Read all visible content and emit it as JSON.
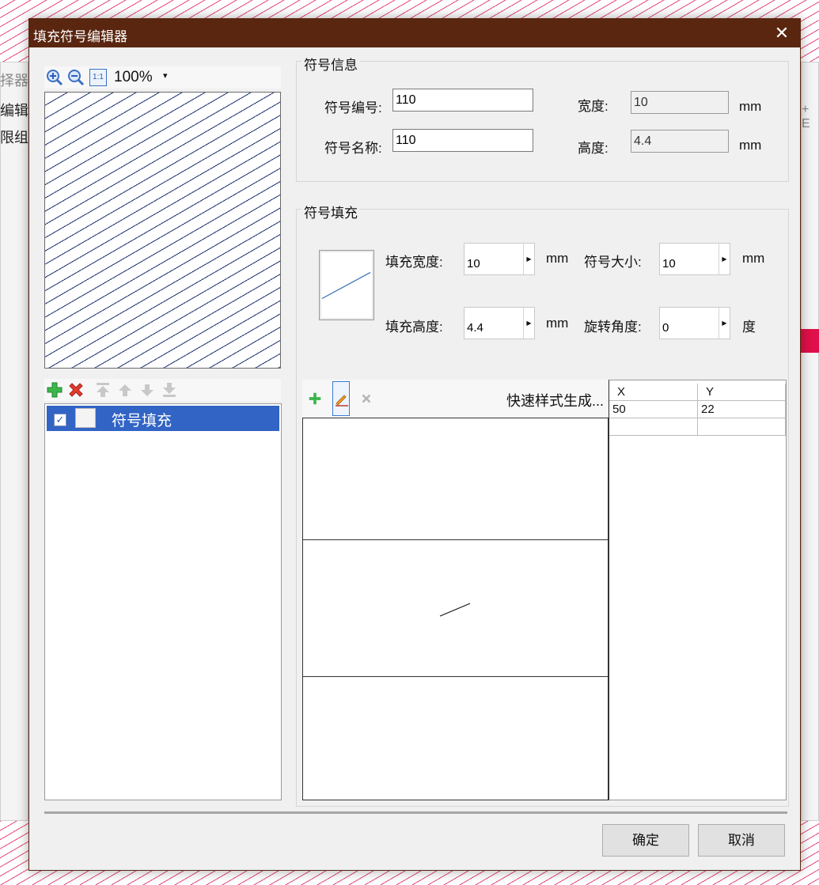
{
  "background_app": {
    "labels": [
      "择器",
      "编辑",
      "限组"
    ],
    "right_fragment": "+ E"
  },
  "dialog": {
    "title": "填充符号编辑器",
    "title_bar_color": "#5a2610",
    "close_glyph": "✕"
  },
  "preview_toolbar": {
    "icons": [
      "zoom-in-icon",
      "zoom-out-icon",
      "actual-size-icon"
    ],
    "actual_size_label": "1:1",
    "zoom_level": "100%"
  },
  "preview": {
    "pattern_color": "#1c2f6e"
  },
  "layer_toolbar": {
    "icons": [
      "add-icon",
      "delete-icon",
      "move-top-icon",
      "move-up-icon",
      "move-down-icon",
      "move-bottom-icon"
    ]
  },
  "layers": {
    "items": [
      {
        "label": "符号填充",
        "checked": true,
        "selected": true
      }
    ]
  },
  "symbol_info": {
    "title": "符号信息",
    "code_label": "符号编号:",
    "code_value": "110",
    "name_label": "符号名称:",
    "name_value": "110",
    "width_label": "宽度:",
    "width_value": "10",
    "width_unit": "mm",
    "height_label": "高度:",
    "height_value": "4.4",
    "height_unit": "mm"
  },
  "symbol_fill": {
    "title": "符号填充",
    "fill_width_label": "填充宽度:",
    "fill_width_value": "10",
    "fill_width_unit": "mm",
    "fill_height_label": "填充高度:",
    "fill_height_value": "4.4",
    "fill_height_unit": "mm",
    "symbol_size_label": "符号大小:",
    "symbol_size_value": "10",
    "symbol_size_unit": "mm",
    "rotation_label": "旋转角度:",
    "rotation_value": "0",
    "rotation_unit": "度"
  },
  "edit_toolbar": {
    "icons": [
      "add-icon",
      "pencil-icon",
      "delete-icon"
    ],
    "quick_style_label": "快速样式生成..."
  },
  "coord_table": {
    "headers": [
      "X",
      "Y"
    ],
    "rows": [
      [
        "50",
        "22"
      ],
      [
        "",
        ""
      ]
    ]
  },
  "buttons": {
    "ok": "确定",
    "cancel": "取消"
  }
}
